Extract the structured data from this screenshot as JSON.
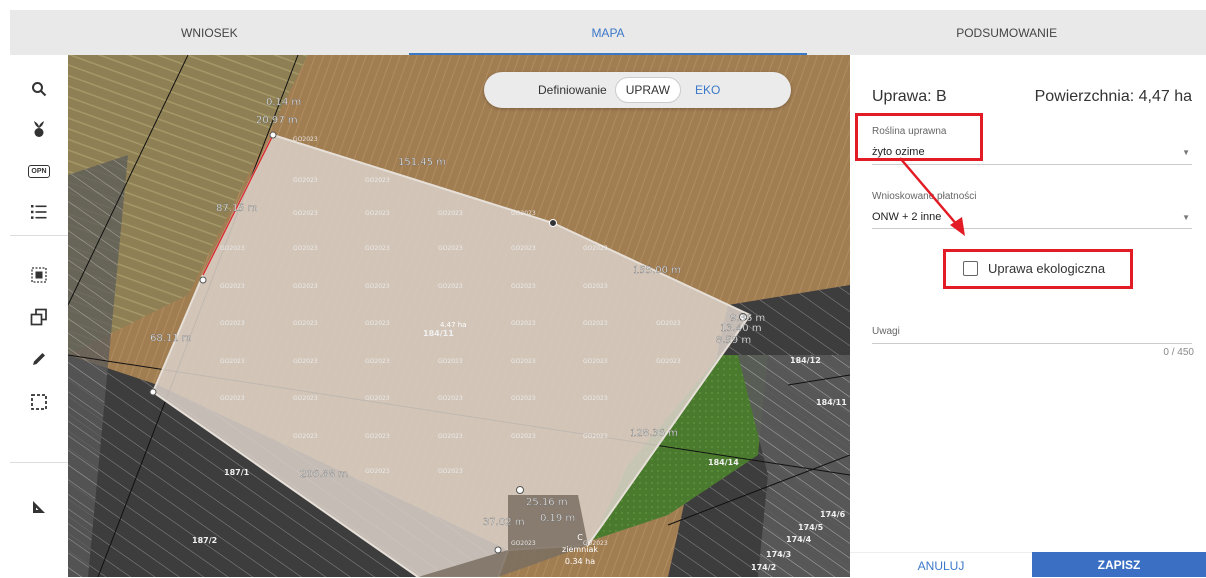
{
  "tabs": [
    {
      "label": "WNIOSEK"
    },
    {
      "label": "MAPA"
    },
    {
      "label": "PODSUMOWANIE"
    }
  ],
  "toolbar": {
    "icons": [
      "search-icon",
      "plant-icon",
      "opn-icon",
      "list-icon",
      "selection-icon",
      "copy-icon",
      "pencil-icon",
      "select-frame-icon",
      "measure-icon"
    ],
    "opn_text": "OPN"
  },
  "mode_toggle": {
    "label": "Definiowanie",
    "option_active": "UPRAW",
    "option_other": "EKO"
  },
  "map": {
    "measurements": [
      "0.14 m",
      "20.97 m",
      "151.45 m",
      "87.15 m",
      "155.00 m",
      "9.36 m",
      "13.40 m",
      "8.59 m",
      "68.11 m",
      "4.47 ha",
      "128.36 m",
      "206.88 m",
      "25.16 m",
      "37.02 m",
      "0.19 m"
    ],
    "parcels": [
      "184/11",
      "184/12",
      "184/11",
      "184/14",
      "187/1",
      "187/2",
      "174/6",
      "174/5",
      "174/4",
      "174/3",
      "174/2"
    ],
    "watermark": "GO2023",
    "small_plot": {
      "letter": "C",
      "crop": "ziemniak",
      "area": "0.34 ha"
    }
  },
  "panel": {
    "crop_title": "Uprawa: B",
    "area_title": "Powierzchnia: 4,47 ha",
    "plant_label": "Roślina uprawna",
    "plant_value": "żyto ozime",
    "payments_label": "Wnioskowane płatności",
    "payments_value": "ONW + 2 inne",
    "eco_checkbox_label": "Uprawa ekologiczna",
    "eco_checked": false,
    "notes_label": "Uwagi",
    "notes_counter": "0 / 450",
    "cancel_label": "ANULUJ",
    "save_label": "ZAPISZ"
  },
  "colors": {
    "accent": "#3b78c8",
    "save_bg": "#3b6fc4",
    "highlight": "#e21b24"
  }
}
